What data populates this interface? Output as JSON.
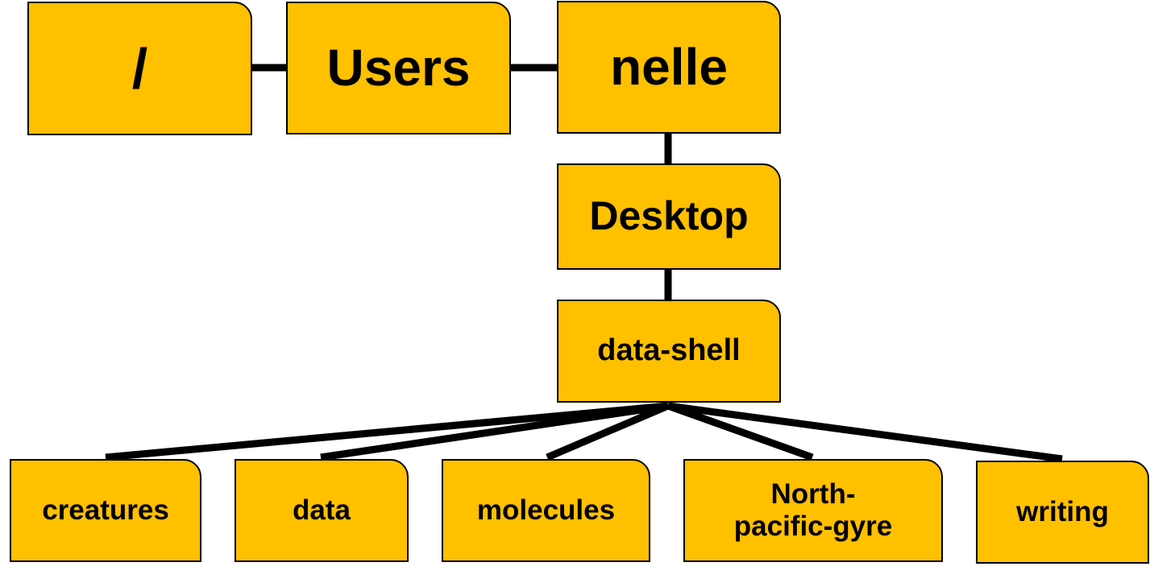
{
  "colors": {
    "node_fill": "#FFC000",
    "line": "#000000"
  },
  "nodes": {
    "root": "/",
    "users": "Users",
    "nelle": "nelle",
    "desktop": "Desktop",
    "data_shell": "data-shell",
    "creatures": "creatures",
    "data": "data",
    "molecules": "molecules",
    "north_pacific_gyre": "North-\npacific-gyre",
    "writing": "writing"
  }
}
